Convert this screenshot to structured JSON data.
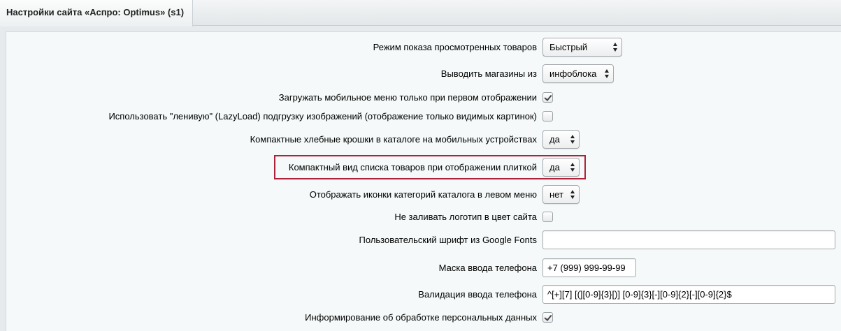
{
  "tab": {
    "title": "Настройки сайта «Аспро: Optimus» (s1)"
  },
  "settings": {
    "viewed_mode": {
      "label": "Режим показа просмотренных товаров",
      "value": "Быстрый"
    },
    "stores_from": {
      "label": "Выводить магазины из",
      "value": "инфоблока"
    },
    "mobile_menu_first": {
      "label": "Загружать мобильное меню только при первом отображении",
      "checked": true
    },
    "lazyload": {
      "label": "Использовать \"ленивую\" (LazyLoad) подгрузку изображений (отображение только видимых картинок)",
      "checked": false
    },
    "compact_breadcrumbs": {
      "label": "Компактные хлебные крошки в каталоге на мобильных устройствах",
      "value": "да"
    },
    "compact_tile_list": {
      "label": "Компактный вид списка товаров при отображении плиткой",
      "value": "да"
    },
    "left_menu_icons": {
      "label": "Отображать иконки категорий каталога в левом меню",
      "value": "нет"
    },
    "no_logo_fill": {
      "label": "Не заливать логотип в цвет сайта",
      "checked": false
    },
    "google_font": {
      "label": "Пользовательский шрифт из Google Fonts",
      "value": ""
    },
    "phone_mask": {
      "label": "Маска ввода телефона",
      "value": "+7 (999) 999-99-99"
    },
    "phone_validation": {
      "label": "Валидация ввода телефона",
      "value": "^[+][7] [(][0-9]{3}[)] [0-9]{3}[-][0-9]{2}[-][0-9]{2}$"
    },
    "personal_data_info": {
      "label": "Информирование об обработке персональных данных",
      "checked": true
    }
  },
  "colors": {
    "highlight_border": "#b0223a",
    "panel_bg": "#f5f9f9",
    "page_bg": "#e7eaec"
  }
}
